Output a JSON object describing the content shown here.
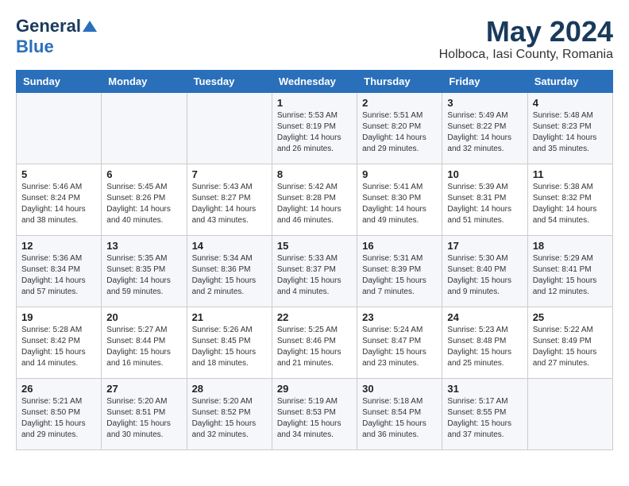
{
  "header": {
    "logo_general": "General",
    "logo_blue": "Blue",
    "month_year": "May 2024",
    "location": "Holboca, Iasi County, Romania"
  },
  "days_of_week": [
    "Sunday",
    "Monday",
    "Tuesday",
    "Wednesday",
    "Thursday",
    "Friday",
    "Saturday"
  ],
  "weeks": [
    [
      {
        "day": "",
        "info": ""
      },
      {
        "day": "",
        "info": ""
      },
      {
        "day": "",
        "info": ""
      },
      {
        "day": "1",
        "info": "Sunrise: 5:53 AM\nSunset: 8:19 PM\nDaylight: 14 hours and 26 minutes."
      },
      {
        "day": "2",
        "info": "Sunrise: 5:51 AM\nSunset: 8:20 PM\nDaylight: 14 hours and 29 minutes."
      },
      {
        "day": "3",
        "info": "Sunrise: 5:49 AM\nSunset: 8:22 PM\nDaylight: 14 hours and 32 minutes."
      },
      {
        "day": "4",
        "info": "Sunrise: 5:48 AM\nSunset: 8:23 PM\nDaylight: 14 hours and 35 minutes."
      }
    ],
    [
      {
        "day": "5",
        "info": "Sunrise: 5:46 AM\nSunset: 8:24 PM\nDaylight: 14 hours and 38 minutes."
      },
      {
        "day": "6",
        "info": "Sunrise: 5:45 AM\nSunset: 8:26 PM\nDaylight: 14 hours and 40 minutes."
      },
      {
        "day": "7",
        "info": "Sunrise: 5:43 AM\nSunset: 8:27 PM\nDaylight: 14 hours and 43 minutes."
      },
      {
        "day": "8",
        "info": "Sunrise: 5:42 AM\nSunset: 8:28 PM\nDaylight: 14 hours and 46 minutes."
      },
      {
        "day": "9",
        "info": "Sunrise: 5:41 AM\nSunset: 8:30 PM\nDaylight: 14 hours and 49 minutes."
      },
      {
        "day": "10",
        "info": "Sunrise: 5:39 AM\nSunset: 8:31 PM\nDaylight: 14 hours and 51 minutes."
      },
      {
        "day": "11",
        "info": "Sunrise: 5:38 AM\nSunset: 8:32 PM\nDaylight: 14 hours and 54 minutes."
      }
    ],
    [
      {
        "day": "12",
        "info": "Sunrise: 5:36 AM\nSunset: 8:34 PM\nDaylight: 14 hours and 57 minutes."
      },
      {
        "day": "13",
        "info": "Sunrise: 5:35 AM\nSunset: 8:35 PM\nDaylight: 14 hours and 59 minutes."
      },
      {
        "day": "14",
        "info": "Sunrise: 5:34 AM\nSunset: 8:36 PM\nDaylight: 15 hours and 2 minutes."
      },
      {
        "day": "15",
        "info": "Sunrise: 5:33 AM\nSunset: 8:37 PM\nDaylight: 15 hours and 4 minutes."
      },
      {
        "day": "16",
        "info": "Sunrise: 5:31 AM\nSunset: 8:39 PM\nDaylight: 15 hours and 7 minutes."
      },
      {
        "day": "17",
        "info": "Sunrise: 5:30 AM\nSunset: 8:40 PM\nDaylight: 15 hours and 9 minutes."
      },
      {
        "day": "18",
        "info": "Sunrise: 5:29 AM\nSunset: 8:41 PM\nDaylight: 15 hours and 12 minutes."
      }
    ],
    [
      {
        "day": "19",
        "info": "Sunrise: 5:28 AM\nSunset: 8:42 PM\nDaylight: 15 hours and 14 minutes."
      },
      {
        "day": "20",
        "info": "Sunrise: 5:27 AM\nSunset: 8:44 PM\nDaylight: 15 hours and 16 minutes."
      },
      {
        "day": "21",
        "info": "Sunrise: 5:26 AM\nSunset: 8:45 PM\nDaylight: 15 hours and 18 minutes."
      },
      {
        "day": "22",
        "info": "Sunrise: 5:25 AM\nSunset: 8:46 PM\nDaylight: 15 hours and 21 minutes."
      },
      {
        "day": "23",
        "info": "Sunrise: 5:24 AM\nSunset: 8:47 PM\nDaylight: 15 hours and 23 minutes."
      },
      {
        "day": "24",
        "info": "Sunrise: 5:23 AM\nSunset: 8:48 PM\nDaylight: 15 hours and 25 minutes."
      },
      {
        "day": "25",
        "info": "Sunrise: 5:22 AM\nSunset: 8:49 PM\nDaylight: 15 hours and 27 minutes."
      }
    ],
    [
      {
        "day": "26",
        "info": "Sunrise: 5:21 AM\nSunset: 8:50 PM\nDaylight: 15 hours and 29 minutes."
      },
      {
        "day": "27",
        "info": "Sunrise: 5:20 AM\nSunset: 8:51 PM\nDaylight: 15 hours and 30 minutes."
      },
      {
        "day": "28",
        "info": "Sunrise: 5:20 AM\nSunset: 8:52 PM\nDaylight: 15 hours and 32 minutes."
      },
      {
        "day": "29",
        "info": "Sunrise: 5:19 AM\nSunset: 8:53 PM\nDaylight: 15 hours and 34 minutes."
      },
      {
        "day": "30",
        "info": "Sunrise: 5:18 AM\nSunset: 8:54 PM\nDaylight: 15 hours and 36 minutes."
      },
      {
        "day": "31",
        "info": "Sunrise: 5:17 AM\nSunset: 8:55 PM\nDaylight: 15 hours and 37 minutes."
      },
      {
        "day": "",
        "info": ""
      }
    ]
  ]
}
